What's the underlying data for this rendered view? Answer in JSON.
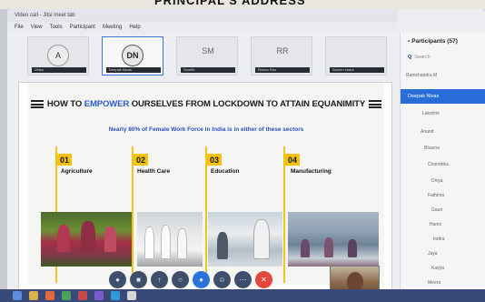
{
  "header_caption": "PRINCIPAL'S ADDRESS",
  "window": {
    "title": "Video call - Jitsi meet tab"
  },
  "menu": [
    "File",
    "View",
    "Tools",
    "Participant",
    "Meeting",
    "Help"
  ],
  "tiles": [
    {
      "initials": "A",
      "label": "Video"
    },
    {
      "initials": "DN",
      "label": "Deepak Nivas"
    },
    {
      "initials": "SM",
      "label": "Sumith"
    },
    {
      "initials": "RR",
      "label": "Rohan Rao"
    },
    {
      "initials": "",
      "label": "Screen share"
    }
  ],
  "slide": {
    "title_pre": "HOW TO",
    "title_em": "EMPOWER",
    "title_post": "OURSELVES FROM LOCKDOWN TO ATTAIN EQUANIMITY",
    "subtitle": "Nearly 80% of Female Work Force in India is in either of these sectors",
    "sectors": [
      {
        "num": "01",
        "name": "Agriculture"
      },
      {
        "num": "02",
        "name": "Health Care"
      },
      {
        "num": "03",
        "name": "Education"
      },
      {
        "num": "04",
        "name": "Manufacturing"
      }
    ]
  },
  "toolbar": [
    "mic-icon",
    "video-icon",
    "share-icon",
    "chat-icon",
    "participants-icon",
    "react-icon",
    "more-icon",
    "end-call-icon"
  ],
  "panel": {
    "title": "Participants (57)",
    "search_placeholder": "Search",
    "participants": [
      "Ramchandra M",
      "Deepak Nivas",
      "Lakshmi",
      "Anand",
      "Bhavna",
      "Chandrika",
      "Divya",
      "Fathima",
      "Gauri",
      "Harini",
      "Indira",
      "Jaya",
      "Kavya",
      "Meera"
    ]
  }
}
